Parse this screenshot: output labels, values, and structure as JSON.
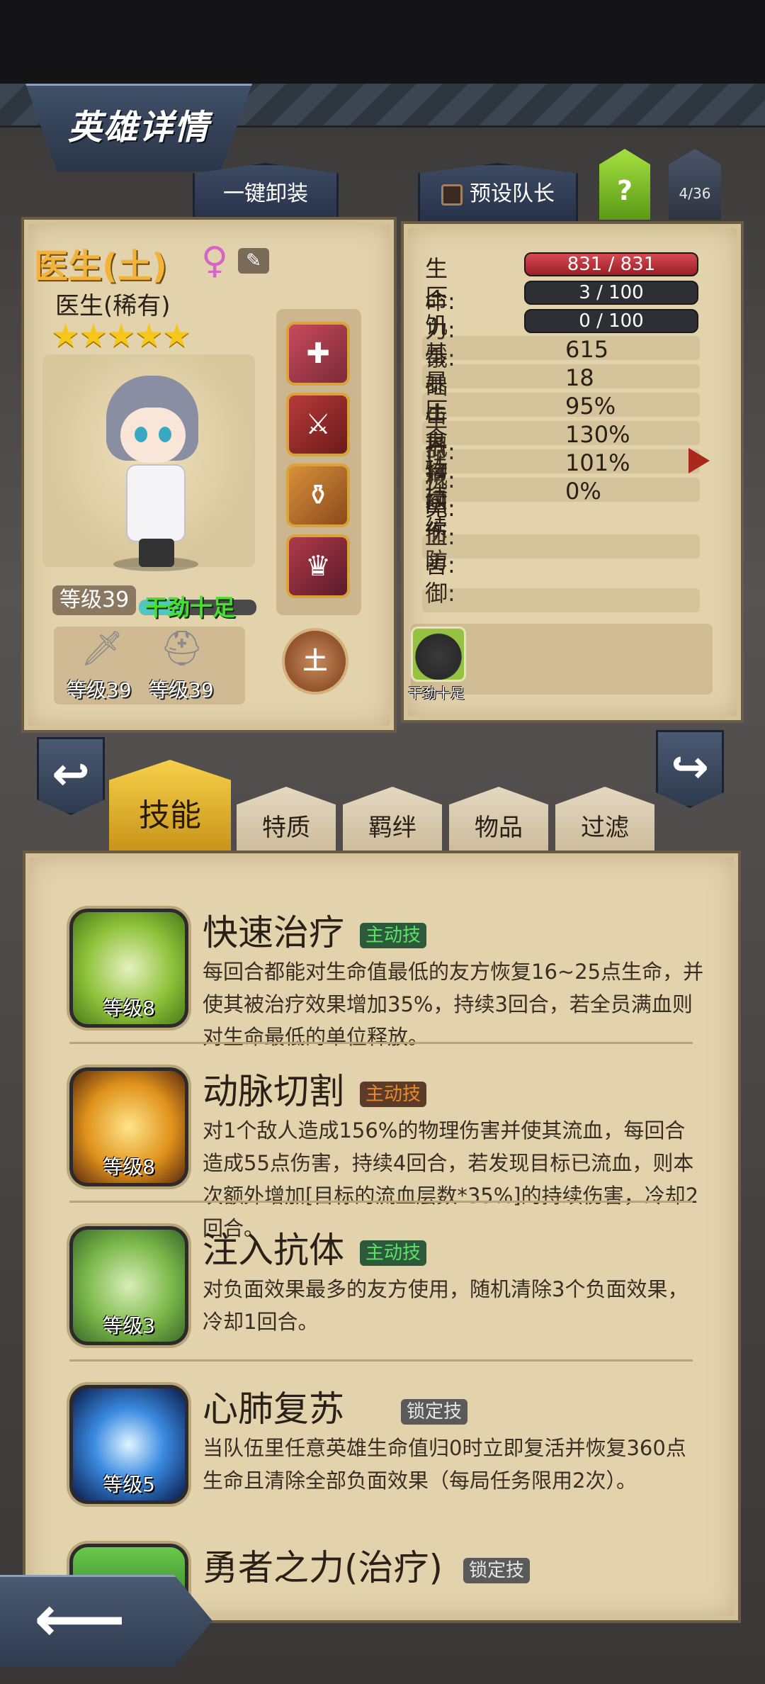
{
  "header": {
    "title": "英雄详情"
  },
  "top_tabs": {
    "unequip": "一键卸装",
    "preset_captain": "预设队长",
    "help": "?",
    "hero_count": "4/36"
  },
  "hero": {
    "name": "医生(土)",
    "gender_icon": "female-icon",
    "class": "医生(稀有)",
    "stars": "★★★★★",
    "level": "等级39",
    "mood": "干劲十足",
    "element": "土",
    "weapon_level": "等级39",
    "armor_level": "等级39",
    "items": [
      "medkit-icon",
      "battle-axe-icon",
      "potion-bag-icon",
      "crown-helmet-icon"
    ]
  },
  "stats": {
    "hp": {
      "label": "生命:",
      "value": "831 / 831",
      "fraction": 1.0
    },
    "stress": {
      "label": "压力:",
      "value": "3 / 100",
      "fraction": 0.03
    },
    "hunger": {
      "label": "饥饿:",
      "value": "0 / 100",
      "fraction": 0.0
    },
    "rows": [
      {
        "label": "基础生命:",
        "value": "615"
      },
      {
        "label": "暴击抵抗:",
        "value": "18"
      },
      {
        "label": "压力减免:",
        "value": "95%"
      },
      {
        "label": "食物回血:",
        "value": "130%"
      },
      {
        "label": "持续伤害:",
        "value": "101%"
      },
      {
        "label": "持续防御:",
        "value": "0%"
      }
    ],
    "status_effect": "干劲十足"
  },
  "bottom_tabs": [
    "技能",
    "特质",
    "羁绊",
    "物品",
    "过滤"
  ],
  "skills": [
    {
      "name": "快速治疗",
      "tag": "主动技",
      "level": "等级8",
      "desc": "每回合都能对生命值最低的友方恢复16~25点生命，并使其被治疗效果增加35%，持续3回合，若全员满血则对生命最低的单位释放。"
    },
    {
      "name": "动脉切割",
      "tag": "主动技",
      "level": "等级8",
      "desc": "对1个敌人造成156%的物理伤害并使其流血，每回合造成55点伤害，持续4回合，若发现目标已流血，则本次额外增加[目标的流血层数*35%]的持续伤害，冷却2回合。"
    },
    {
      "name": "注入抗体",
      "tag": "主动技",
      "level": "等级3",
      "desc": "对负面效果最多的友方使用，随机清除3个负面效果，冷却1回合。"
    },
    {
      "name": "心肺复苏",
      "tag": "锁定技",
      "level": "等级5",
      "desc": "当队伍里任意英雄生命值归0时立即复活并恢复360点生命且清除全部负面效果（每局任务限用2次）。"
    },
    {
      "name": "勇者之力(治疗)",
      "tag": "锁定技",
      "level": ""
    }
  ],
  "colors": {
    "hp_bar": "#c8343e",
    "active_tag": "#5de06a",
    "passive_tag": "#e6e6e6",
    "gold": "#f2b33a"
  }
}
